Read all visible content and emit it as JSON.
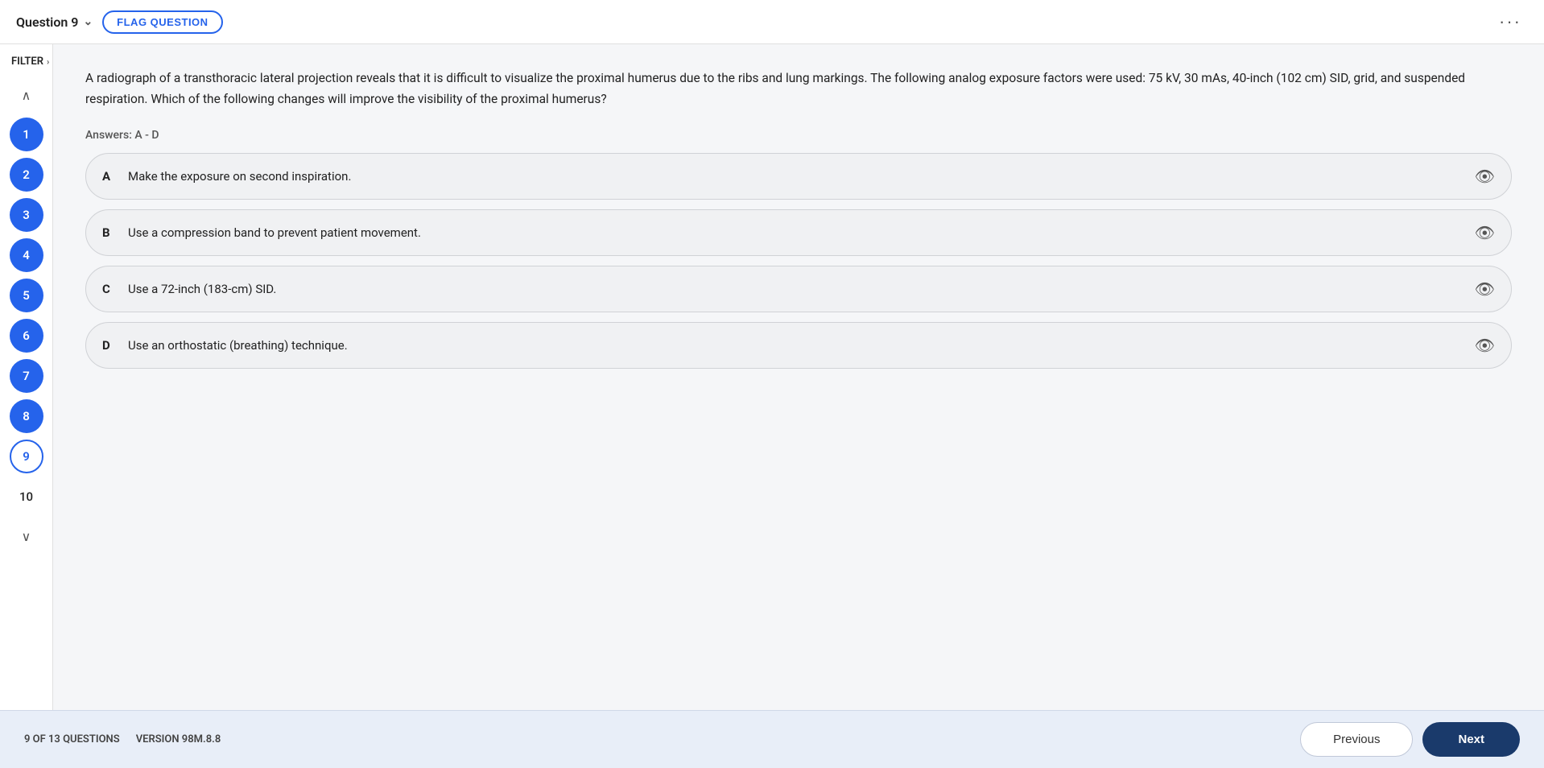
{
  "header": {
    "question_label": "Question 9",
    "flag_button": "FLAG QUESTION",
    "more_button": "···"
  },
  "filter": {
    "label": "FILTER",
    "arrow": "›"
  },
  "sidebar": {
    "collapse_icon": "∧",
    "expand_icon": "∨",
    "questions": [
      {
        "number": "1",
        "state": "normal"
      },
      {
        "number": "2",
        "state": "normal"
      },
      {
        "number": "3",
        "state": "normal"
      },
      {
        "number": "4",
        "state": "normal"
      },
      {
        "number": "5",
        "state": "normal"
      },
      {
        "number": "6",
        "state": "normal"
      },
      {
        "number": "7",
        "state": "normal"
      },
      {
        "number": "8",
        "state": "normal"
      },
      {
        "number": "9",
        "state": "current"
      },
      {
        "number": "10",
        "state": "plain"
      }
    ]
  },
  "question": {
    "text": "A radiograph of a transthoracic lateral projection reveals that it is difficult to visualize the proximal humerus due to the ribs and lung markings. The following analog exposure factors were used: 75 kV, 30 mAs, 40-inch (102 cm) SID, grid, and suspended respiration. Which of the following changes will improve the visibility of the proximal humerus?",
    "answers_label": "Answers: A - D",
    "options": [
      {
        "letter": "A",
        "text": "Make the exposure on second inspiration."
      },
      {
        "letter": "B",
        "text": "Use a compression band to prevent patient movement."
      },
      {
        "letter": "C",
        "text": "Use a 72-inch (183-cm) SID."
      },
      {
        "letter": "D",
        "text": "Use an orthostatic (breathing) technique."
      }
    ]
  },
  "bottom": {
    "questions_count": "9 OF 13 QUESTIONS",
    "version": "VERSION 98M.8.8",
    "previous_button": "Previous",
    "next_button": "Next"
  }
}
